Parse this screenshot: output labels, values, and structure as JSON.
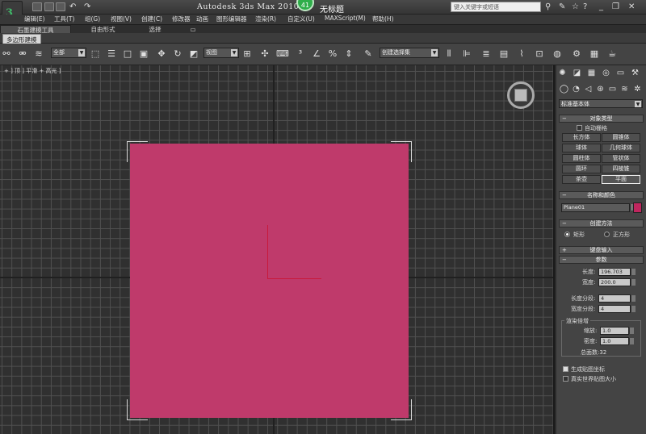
{
  "titlebar": {
    "logo": "3",
    "app_title": "Autodesk 3ds Max  2010",
    "badge": "41",
    "doc_title": "无标题",
    "search_placeholder": "键入关键字或短语"
  },
  "menu": {
    "items": [
      "编辑(E)",
      "工具(T)",
      "组(G)",
      "视图(V)",
      "创建(C)",
      "修改器",
      "动画",
      "图形编辑器",
      "渲染(R)",
      "自定义(U)",
      "MAXScript(M)",
      "帮助(H)"
    ]
  },
  "ribbon": {
    "tabs": [
      "石墨建模工具",
      "自由形式",
      "选择"
    ],
    "sub_label": "多边形建模"
  },
  "toolbar": {
    "selection_filter": "全部",
    "ref_coord": "视图",
    "named_selection": "创建选择集"
  },
  "viewport": {
    "label": "+ ] 顶 ] 平滑 + 高光 ]",
    "plane_color": "#bf3a6b"
  },
  "panel": {
    "category_dropdown": "标准基本体",
    "object_type": {
      "title": "对象类型",
      "autogrid_label": "自动栅格",
      "buttons": [
        "长方体",
        "圆锥体",
        "球体",
        "几何球体",
        "圆柱体",
        "管状体",
        "圆环",
        "四棱锥",
        "茶壶",
        "平面"
      ],
      "selected": "平面"
    },
    "name_color": {
      "title": "名称和颜色",
      "name": "Plane01",
      "swatch_color": "#c0265e"
    },
    "creation_method": {
      "title": "创建方法",
      "options": [
        "矩形",
        "正方形"
      ],
      "selected": "矩形"
    },
    "keyboard_entry": {
      "title": "键盘输入"
    },
    "parameters": {
      "title": "参数",
      "length_label": "长度:",
      "length_value": "196.703",
      "width_label": "宽度:",
      "width_value": "200.0",
      "length_segs_label": "长度分段:",
      "length_segs_value": "4",
      "width_segs_label": "宽度分段:",
      "width_segs_value": "4",
      "render_mult_title": "渲染倍增",
      "scale_label": "缩放:",
      "scale_value": "1.0",
      "density_label": "密度:",
      "density_value": "1.0",
      "total_faces": "总面数:32",
      "gen_mapping_label": "生成贴图坐标",
      "real_world_label": "真实世界贴图大小"
    }
  }
}
